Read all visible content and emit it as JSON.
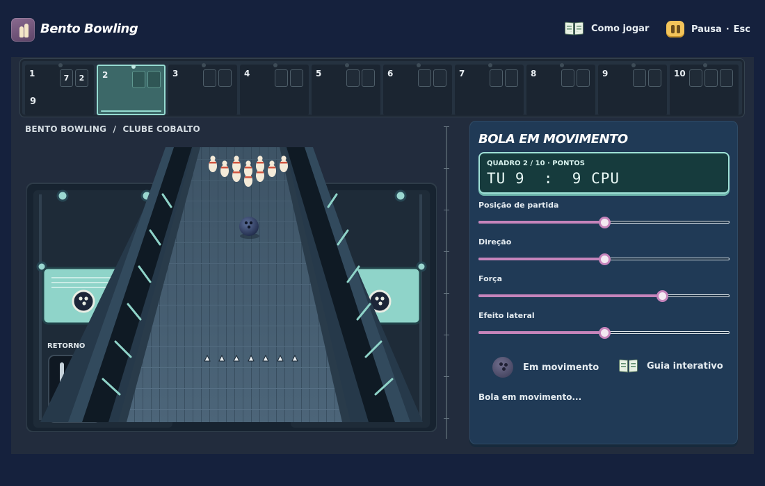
{
  "header": {
    "app_title": "Bento Bowling",
    "app_icon": "bowling-pins-icon",
    "how_to_play": "Como jogar",
    "how_to_play_icon": "book-icon",
    "pause": "Pausa",
    "pause_sep": "·",
    "pause_key": "Esc",
    "pause_icon": "pause-icon"
  },
  "scoreboard": {
    "frames": [
      {
        "num": "1",
        "rolls": [
          "7",
          "2"
        ],
        "total": "9"
      },
      {
        "num": "2",
        "rolls": [
          "",
          ""
        ],
        "total": ""
      },
      {
        "num": "3",
        "rolls": [
          "",
          ""
        ],
        "total": ""
      },
      {
        "num": "4",
        "rolls": [
          "",
          ""
        ],
        "total": ""
      },
      {
        "num": "5",
        "rolls": [
          "",
          ""
        ],
        "total": ""
      },
      {
        "num": "6",
        "rolls": [
          "",
          ""
        ],
        "total": ""
      },
      {
        "num": "7",
        "rolls": [
          "",
          ""
        ],
        "total": ""
      },
      {
        "num": "8",
        "rolls": [
          "",
          ""
        ],
        "total": ""
      },
      {
        "num": "9",
        "rolls": [
          "",
          ""
        ],
        "total": ""
      },
      {
        "num": "10",
        "rolls": [
          "",
          "",
          ""
        ],
        "total": ""
      }
    ],
    "active_frame": 2
  },
  "breadcrumb": {
    "root": "BENTO BOWLING",
    "sep": "/",
    "current": "CLUBE COBALTO"
  },
  "lane": {
    "return_label": "RETORNO",
    "pins_standing": 10,
    "ball_icon": "bowling-ball-icon"
  },
  "panel": {
    "title": "BOLA EM MOVIMENTO",
    "scoreline_sub": "QUADRO 2 / 10 · PONTOS",
    "scoreline": "TU 9  :  9 CPU",
    "sliders": [
      {
        "label": "Posição de partida",
        "value": 0.5
      },
      {
        "label": "Direção",
        "value": 0.5
      },
      {
        "label": "Força",
        "value": 0.73
      },
      {
        "label": "Efeito lateral",
        "value": 0.5
      }
    ],
    "motion_label": "Em movimento",
    "guide_label": "Guia interativo",
    "status_text": "Bola em movimento...",
    "colors": {
      "accent": "#c684bb",
      "lcd_border": "#9fe1d7",
      "panel_bg": "#203a56"
    }
  }
}
